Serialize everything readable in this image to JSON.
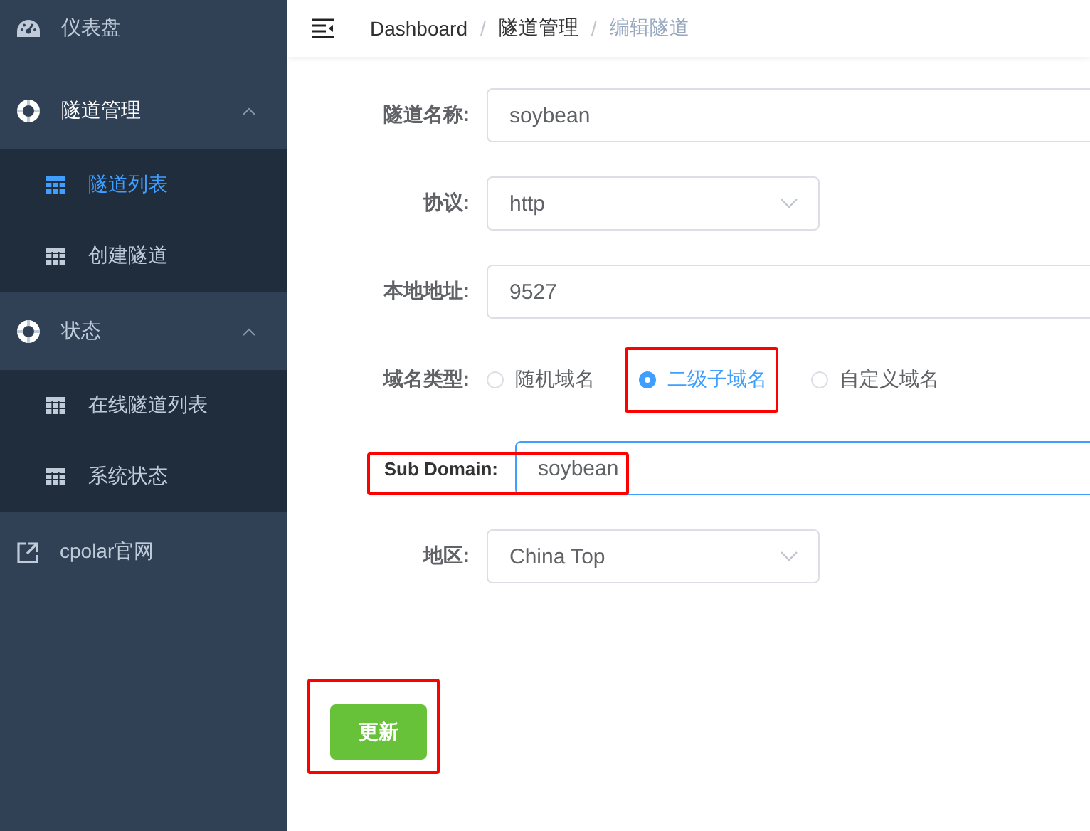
{
  "sidebar": {
    "items": [
      {
        "kind": "page",
        "label": "仪表盘"
      },
      {
        "kind": "group",
        "label": "隧道管理",
        "expanded": true,
        "children": [
          {
            "label": "隧道列表",
            "selected": true
          },
          {
            "label": "创建隧道",
            "selected": false
          }
        ]
      },
      {
        "kind": "group",
        "label": "状态",
        "expanded": true,
        "children": [
          {
            "label": "在线隧道列表",
            "selected": false
          },
          {
            "label": "系统状态",
            "selected": false
          }
        ]
      },
      {
        "kind": "external",
        "label": "cpolar官网"
      }
    ]
  },
  "breadcrumb": [
    {
      "kind": "item",
      "label": "Dashboard",
      "current": false
    },
    {
      "kind": "separator",
      "label": "/"
    },
    {
      "kind": "item",
      "label": "隧道管理",
      "current": false
    },
    {
      "kind": "separator",
      "label": "/"
    },
    {
      "kind": "item",
      "label": "编辑隧道",
      "current": true
    }
  ],
  "form": {
    "rows": [
      {
        "kind": "input",
        "label": "隧道名称:",
        "value": "soybean",
        "focused": false
      },
      {
        "kind": "select",
        "label": "协议:",
        "value": "http"
      },
      {
        "kind": "input",
        "label": "本地地址:",
        "value": "9527",
        "focused": false
      },
      {
        "kind": "radio",
        "label": "域名类型:",
        "options": [
          {
            "label": "随机域名",
            "selected": false,
            "annotated": false
          },
          {
            "label": "二级子域名",
            "selected": true,
            "annotated": true
          },
          {
            "label": "自定义域名",
            "selected": false,
            "annotated": false
          }
        ]
      },
      {
        "kind": "input",
        "label": "Sub Domain:",
        "value": "soybean",
        "focused": true,
        "annotated": true
      },
      {
        "kind": "select",
        "label": "地区:",
        "value": "China Top"
      }
    ],
    "submit": {
      "label": "更新",
      "annotated": true
    }
  }
}
